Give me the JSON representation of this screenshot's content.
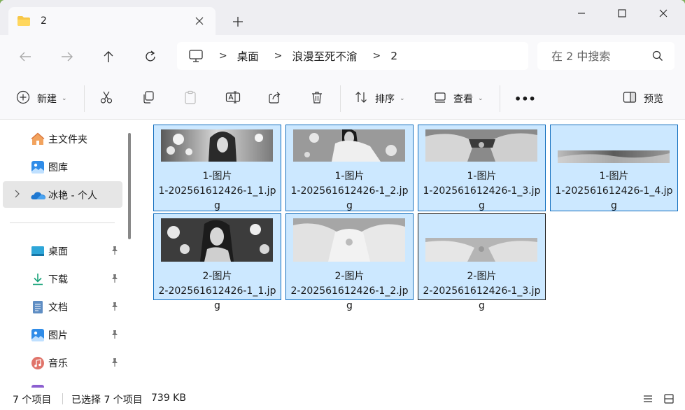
{
  "tab": {
    "title": "2",
    "folder_icon": "folder-icon"
  },
  "window_controls": {
    "minimize": "minimize-icon",
    "maximize": "maximize-icon",
    "close": "close-icon"
  },
  "address": {
    "breadcrumbs": [
      "桌面",
      "浪漫至死不渝",
      "2"
    ],
    "separator": ">",
    "search_placeholder": "在 2 中搜索"
  },
  "toolbar": {
    "new_label": "新建",
    "sort_label": "排序",
    "view_label": "查看",
    "more_label": "•••",
    "preview_label": "预览",
    "chevron": "⌄"
  },
  "sidebar": {
    "top_items": [
      {
        "label": "主文件夹",
        "icon": "home-icon"
      },
      {
        "label": "图库",
        "icon": "gallery-icon"
      },
      {
        "label": "冰艳 - 个人",
        "icon": "onedrive-icon",
        "selected": true
      }
    ],
    "quick_items": [
      {
        "label": "桌面",
        "icon": "desktop-icon",
        "pinned": true
      },
      {
        "label": "下载",
        "icon": "download-icon",
        "pinned": true
      },
      {
        "label": "文档",
        "icon": "documents-icon",
        "pinned": true
      },
      {
        "label": "图片",
        "icon": "pictures-icon",
        "pinned": true
      },
      {
        "label": "音乐",
        "icon": "music-icon",
        "pinned": true
      }
    ]
  },
  "files": [
    {
      "caption": "1-图片",
      "name": "1-202561612426-1_1.jpg"
    },
    {
      "caption": "1-图片",
      "name": "1-202561612426-1_2.jpg"
    },
    {
      "caption": "1-图片",
      "name": "1-202561612426-1_3.jpg"
    },
    {
      "caption": "1-图片",
      "name": "1-202561612426-1_4.jpg"
    },
    {
      "caption": "2-图片",
      "name": "2-202561612426-1_1.jpg"
    },
    {
      "caption": "2-图片",
      "name": "2-202561612426-1_2.jpg"
    },
    {
      "caption": "2-图片",
      "name": "2-202561612426-1_3.jpg"
    }
  ],
  "status": {
    "item_count": "7 个项目",
    "selection": "已选择 7 个项目",
    "size": "739 KB"
  },
  "colors": {
    "selection_bg": "#cce8ff",
    "selection_border": "#0f6cbd",
    "chrome_bg": "#f9f9fb"
  }
}
